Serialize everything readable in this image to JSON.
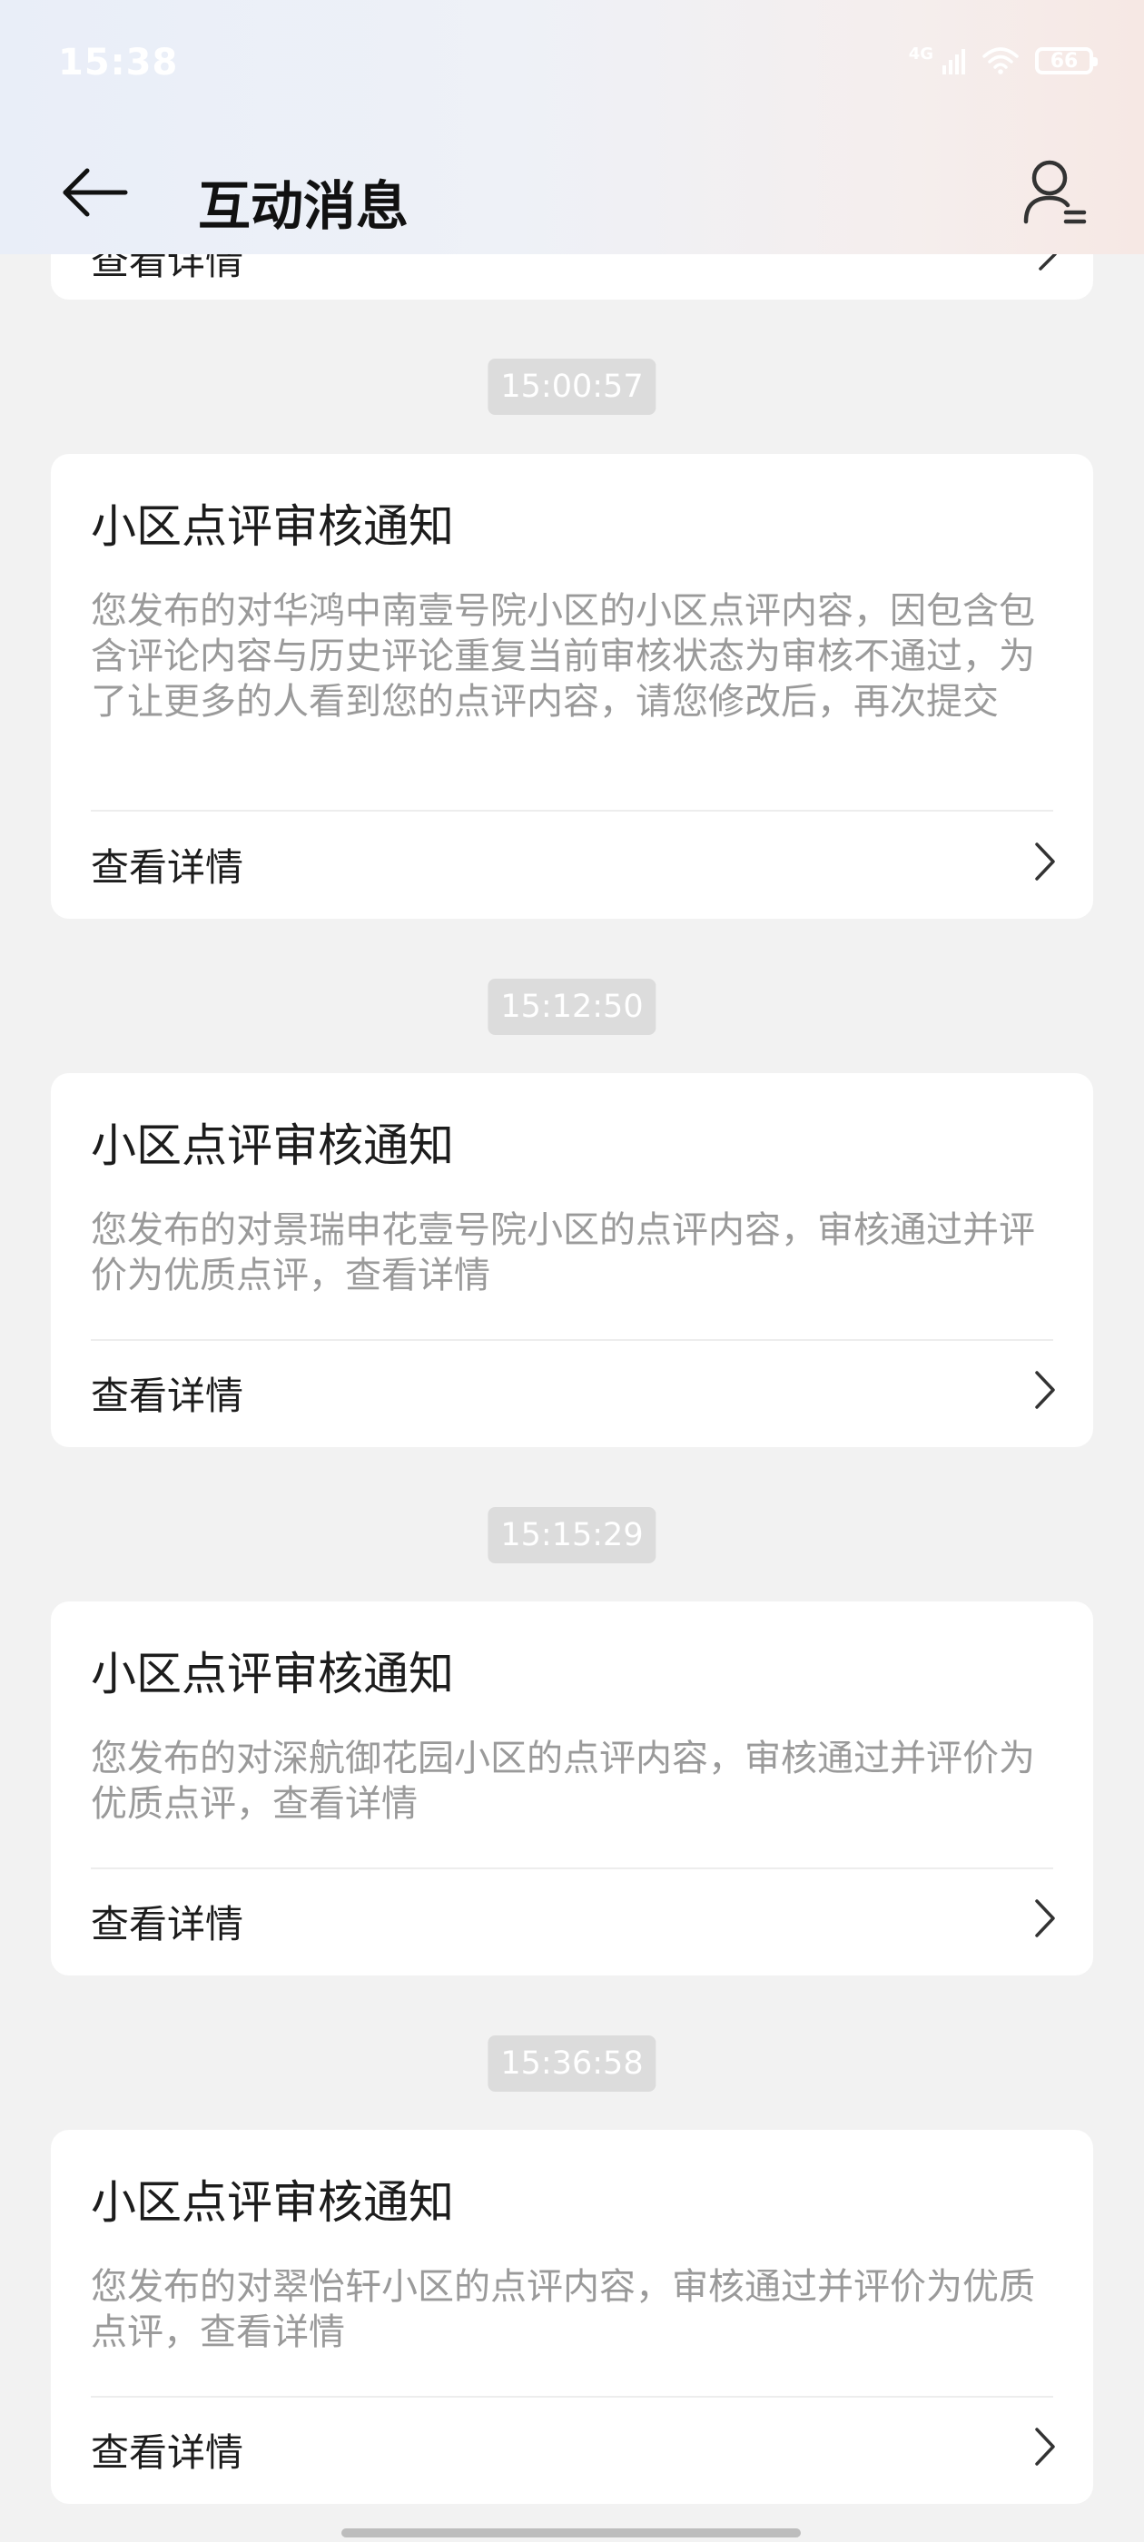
{
  "status_bar": {
    "time": "15:38",
    "network": "4G",
    "battery": "66"
  },
  "nav": {
    "title": "互动消息"
  },
  "partial_item": {
    "link": "查看详情"
  },
  "messages": [
    {
      "timestamp": "15:00:57",
      "title": "小区点评审核通知",
      "body": "您发布的对华鸿中南壹号院小区的小区点评内容，因包含包含评论内容与历史评论重复当前审核状态为审核不通过，为了让更多的人看到您的点评内容，请您修改后，再次提交",
      "link": "查看详情"
    },
    {
      "timestamp": "15:12:50",
      "title": "小区点评审核通知",
      "body": "您发布的对景瑞申花壹号院小区的点评内容，审核通过并评价为优质点评，查看详情",
      "link": "查看详情"
    },
    {
      "timestamp": "15:15:29",
      "title": "小区点评审核通知",
      "body": "您发布的对深航御花园小区的点评内容，审核通过并评价为优质点评，查看详情",
      "link": "查看详情"
    },
    {
      "timestamp": "15:36:58",
      "title": "小区点评审核通知",
      "body": "您发布的对翠怡轩小区的点评内容，审核通过并评价为优质点评，查看详情",
      "link": "查看详情"
    }
  ]
}
